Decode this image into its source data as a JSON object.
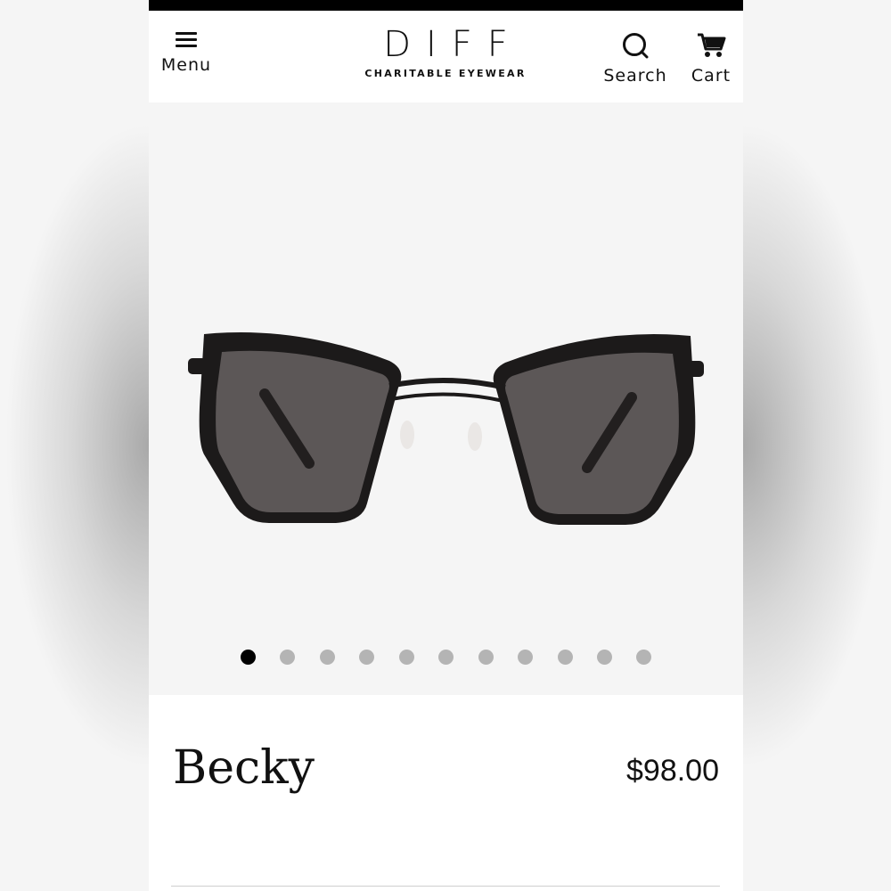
{
  "header": {
    "menu_label": "Menu",
    "search_label": "Search",
    "cart_label": "Cart",
    "logo_main": "DIFF",
    "logo_sub": "CHARITABLE EYEWEAR"
  },
  "gallery": {
    "product_image_icon": "cat-eye-sunglasses",
    "total_images": 11,
    "active_index": 0
  },
  "product": {
    "name": "Becky",
    "price": "$98.00"
  },
  "colors": {
    "frame": "#1c1a1a",
    "lens": "#5a5555",
    "active_dot": "#000000",
    "inactive_dot": "#b4b4b4"
  }
}
